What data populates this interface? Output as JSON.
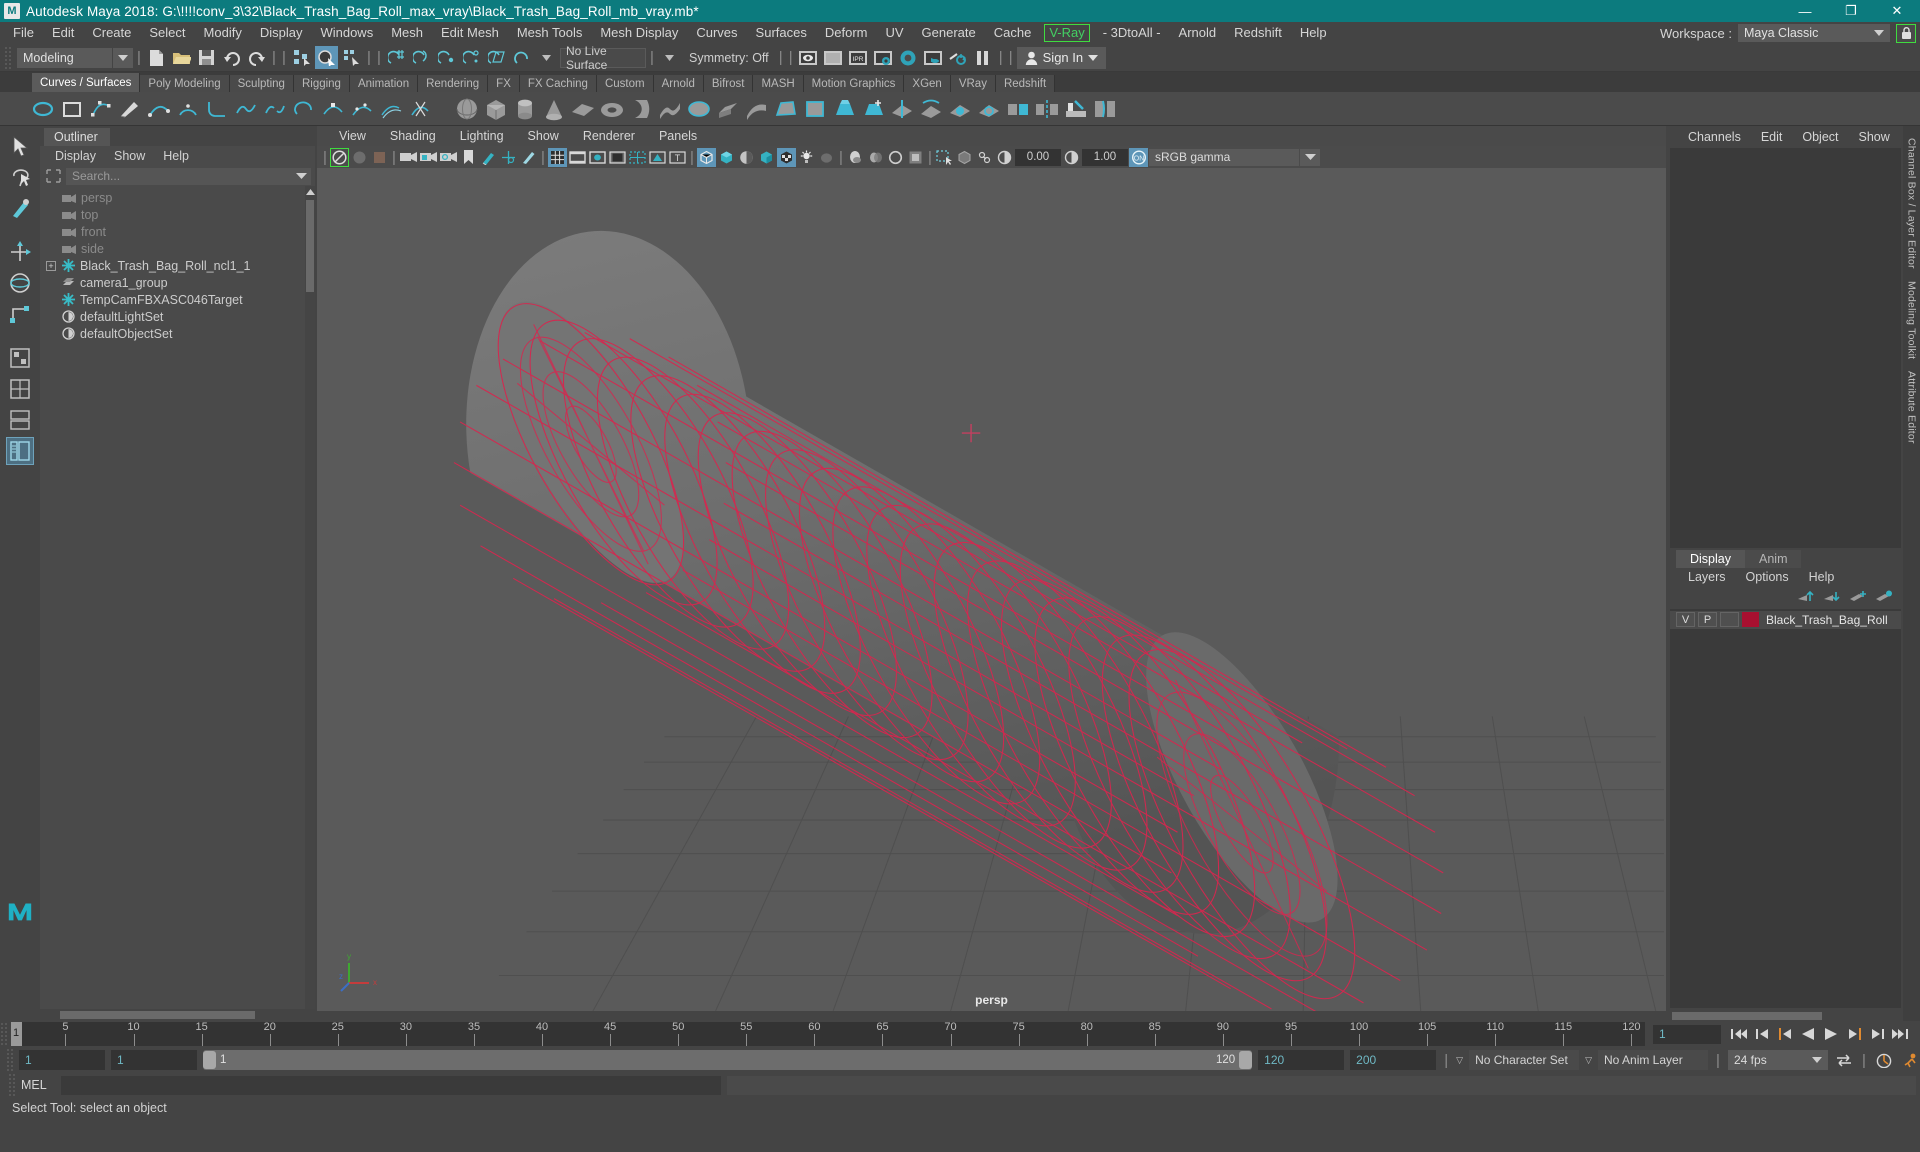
{
  "titlebar": {
    "app_icon": "maya-logo-icon",
    "title": "Autodesk Maya 2018: G:\\!!!!conv_3\\32\\Black_Trash_Bag_Roll_max_vray\\Black_Trash_Bag_Roll_mb_vray.mb*",
    "minimize": "—",
    "maximize": "❐",
    "close": "✕",
    "bg_color": "#0c7b7e"
  },
  "menubar": {
    "items": [
      "File",
      "Edit",
      "Create",
      "Select",
      "Modify",
      "Display",
      "Windows",
      "Mesh",
      "Edit Mesh",
      "Mesh Tools",
      "Mesh Display",
      "Curves",
      "Surfaces",
      "Deform",
      "UV",
      "Generate",
      "Cache"
    ],
    "vray": "V-Ray",
    "items_after": [
      "- 3DtoAll -",
      "Arnold",
      "Redshift",
      "Help"
    ],
    "workspace_label": "Workspace :",
    "workspace_value": "Maya Classic",
    "lock_icon": "lock-icon",
    "highlight_color": "#3fdc3f"
  },
  "statusbar": {
    "mode": "Modeling",
    "new_icon": "new-scene-icon",
    "open_icon": "open-scene-icon",
    "save_icon": "save-scene-icon",
    "undo_icon": "undo-icon",
    "redo_icon": "redo-icon",
    "select_hierarchy_icon": "select-by-hierarchy-icon",
    "select_object_icon": "select-by-object-icon",
    "select_component_icon": "select-by-component-icon",
    "snap_grid_icon": "snap-to-grid-icon",
    "snap_curve_icon": "snap-to-curve-icon",
    "snap_point_icon": "snap-to-point-icon",
    "snap_projected_icon": "snap-to-projected-center-icon",
    "snap_view_icon": "snap-to-view-plane-icon",
    "magnet_icon": "magnet-icon",
    "live_surface": "No Live Surface",
    "symmetry": "Symmetry: Off",
    "render_icon": "render-current-frame-icon",
    "render_seq_icon": "render-sequence-icon",
    "ipr_icon": "ipr-render-icon",
    "render_settings_icon": "render-settings-icon",
    "hypershade_icon": "hypershade-icon",
    "render_setup_icon": "render-setup-icon",
    "light_editor_icon": "light-editor-icon",
    "pause_icon": "pause-icon",
    "signin_label": "Sign In",
    "user_icon": "user-avatar-icon"
  },
  "shelf": {
    "tabs": [
      "Curves / Surfaces",
      "Poly Modeling",
      "Sculpting",
      "Rigging",
      "Animation",
      "Rendering",
      "FX",
      "FX Caching",
      "Custom",
      "Arnold",
      "Bifrost",
      "MASH",
      "Motion Graphics",
      "XGen",
      "VRay",
      "Redshift"
    ],
    "active_tab": "Curves / Surfaces",
    "icons": [
      "nurbs-circle-icon",
      "nurbs-square-icon",
      "cv-curve-tool-icon",
      "pencil-curve-tool-icon",
      "bezier-curve-tool-icon",
      "arc-three-point-icon",
      "curve-fillet-icon",
      "attach-curves-icon",
      "detach-curves-icon",
      "open-close-curve-icon",
      "insert-knot-icon",
      "rebuild-curve-icon",
      "offset-curve-icon",
      "cut-curve-icon",
      "nurbs-sphere-icon",
      "nurbs-cube-icon",
      "nurbs-cylinder-icon",
      "nurbs-cone-icon",
      "nurbs-plane-icon",
      "nurbs-torus-icon",
      "revolve-icon",
      "loft-icon",
      "planar-icon",
      "extrude-icon",
      "birail-icon",
      "boundary-icon",
      "square-surface-icon",
      "bevel-icon",
      "bevel-plus-icon",
      "intersect-surfaces-icon",
      "project-curve-icon",
      "trim-tool-icon",
      "untrim-icon",
      "attach-surfaces-icon",
      "detach-surfaces-icon",
      "sculpt-geometry-icon",
      "surface-fillet-icon"
    ]
  },
  "toolstrip": {
    "icons": [
      "select-tool-icon",
      "lasso-select-tool-icon",
      "paint-select-tool-icon",
      "move-tool-icon",
      "rotate-tool-icon",
      "scale-tool-icon",
      "last-tool-icon",
      "show-manipulator-icon",
      "toggle-layout-icon",
      "four-view-layout-icon",
      "persp-outliner-layout-icon",
      "persp-graph-layout-icon"
    ],
    "selected": "persp-outliner-layout-icon",
    "logo_icon": "maya-m-logo-icon"
  },
  "outliner": {
    "tab_label": "Outliner",
    "menu": [
      "Display",
      "Show",
      "Help"
    ],
    "search_placeholder": "Search...",
    "search_value": "",
    "filter_icon": "outliner-filter-icon",
    "items": [
      {
        "label": "persp",
        "icon": "camera-icon",
        "dim": true,
        "expandable": false
      },
      {
        "label": "top",
        "icon": "camera-icon",
        "dim": true,
        "expandable": false
      },
      {
        "label": "front",
        "icon": "camera-icon",
        "dim": true,
        "expandable": false
      },
      {
        "label": "side",
        "icon": "camera-icon",
        "dim": true,
        "expandable": false
      },
      {
        "label": "Black_Trash_Bag_Roll_ncl1_1",
        "icon": "transform-node-icon",
        "dim": false,
        "expandable": true
      },
      {
        "label": "camera1_group",
        "icon": "group-node-icon",
        "dim": false,
        "expandable": false
      },
      {
        "label": "TempCamFBXASC046Target",
        "icon": "transform-node-icon",
        "dim": false,
        "expandable": false
      },
      {
        "label": "defaultLightSet",
        "icon": "set-node-icon",
        "dim": false,
        "expandable": false
      },
      {
        "label": "defaultObjectSet",
        "icon": "set-node-icon",
        "dim": false,
        "expandable": false
      }
    ]
  },
  "viewport": {
    "menu": [
      "View",
      "Shading",
      "Lighting",
      "Show",
      "Renderer",
      "Panels"
    ],
    "camera_label": "persp",
    "exposure_value": "0.00",
    "gamma_value": "1.00",
    "color_space": "sRGB gamma",
    "toolbar_icons": [
      "select-camera-icon",
      "lock-camera-icon",
      "camera-attributes-icon",
      "bookmark-icon",
      "image-plane-icon",
      "two-d-pan-zoom-icon",
      "oil-paint-icon",
      "grid-toggle-icon",
      "film-gate-icon",
      "resolution-gate-icon",
      "gate-mask-icon",
      "field-chart-icon",
      "safe-action-icon",
      "safe-title-icon",
      "wireframe-icon",
      "smooth-shade-icon",
      "shaded-textured-icon",
      "flat-shade-icon",
      "wireframe-on-shaded-icon",
      "texture-toggle-icon",
      "lights-toggle-icon",
      "shadows-icon",
      "screen-space-ao-icon",
      "motion-blur-icon",
      "multisample-icon",
      "isolate-select-icon",
      "xray-icon",
      "xray-joints-icon",
      "exposure-icon",
      "gamma-icon",
      "color-management-icon"
    ],
    "model": {
      "name": "Black_Trash_Bag_Roll",
      "wireframe_color": "#d6274f",
      "shape": "cylinder-roll"
    },
    "axis_labels": [
      "y",
      "x",
      "z"
    ]
  },
  "channelbox": {
    "menu": [
      "Channels",
      "Edit",
      "Object",
      "Show"
    ],
    "rows": []
  },
  "layers": {
    "tabs": [
      "Display",
      "Anim"
    ],
    "active_tab": "Display",
    "menu": [
      "Layers",
      "Options",
      "Help"
    ],
    "buttons": [
      "move-layer-up-icon",
      "move-layer-down-icon",
      "new-layer-from-selection-icon",
      "new-layer-icon"
    ],
    "rows": [
      {
        "visibility": "V",
        "playback": "P",
        "shading": "",
        "color": "#a81030",
        "name": "Black_Trash_Bag_Roll"
      }
    ]
  },
  "vtabs": [
    "Channel Box / Layer Editor",
    "Modeling Toolkit",
    "Attribute Editor"
  ],
  "timeslider": {
    "ticks": [
      5,
      10,
      15,
      20,
      25,
      30,
      35,
      40,
      45,
      50,
      55,
      60,
      65,
      70,
      75,
      80,
      85,
      90,
      95,
      100,
      105,
      110,
      115,
      120
    ],
    "start": 1,
    "end": 120,
    "current": "1",
    "current_display": "1",
    "playback_icons": [
      "go-to-start-icon",
      "step-back-keyframe-icon",
      "step-back-frame-icon",
      "play-backwards-icon",
      "play-forwards-icon",
      "step-forward-frame-icon",
      "step-forward-keyframe-icon",
      "go-to-end-icon"
    ]
  },
  "rangeslider": {
    "anim_start": "1",
    "range_start": "1",
    "slider_min_label": "1",
    "slider_max_label": "120",
    "range_end": "120",
    "anim_end": "200",
    "character_set": "No Character Set",
    "anim_layer": "No Anim Layer",
    "fps": "24 fps",
    "loop_icon": "playback-loop-icon",
    "auto_key_icon": "auto-keyframe-icon",
    "anim_prefs_icon": "animation-preferences-icon"
  },
  "command_line": {
    "label": "MEL",
    "input_value": "",
    "output_value": ""
  },
  "statusline": {
    "text": "Select Tool: select an object"
  }
}
